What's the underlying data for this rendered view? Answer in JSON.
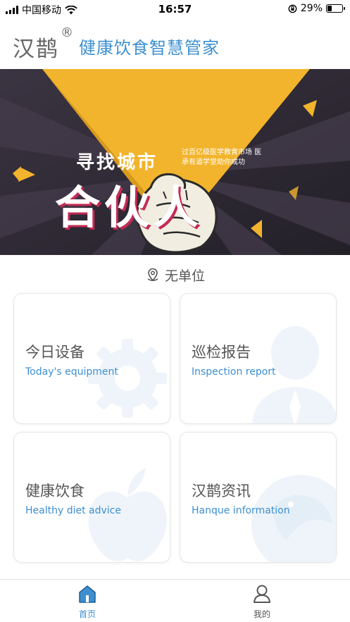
{
  "status_bar": {
    "carrier": "中国移动",
    "time": "16:57",
    "battery": "29%",
    "battery_level": 0.29
  },
  "header": {
    "brand": "汉鹊",
    "reg_mark": "®",
    "tagline": "健康饮食智慧管家"
  },
  "banner": {
    "headline": "寻找城市",
    "subline": "过百亿级医学教育市场 医承有道学堂助你成功",
    "main": "合伙人"
  },
  "location": {
    "text": "无单位"
  },
  "cards": [
    {
      "title": "今日设备",
      "subtitle": "Today's equipment"
    },
    {
      "title": "巡检报告",
      "subtitle": "Inspection report"
    },
    {
      "title": "健康饮食",
      "subtitle": "Healthy diet advice"
    },
    {
      "title": "汉鹊资讯",
      "subtitle": "Hanque information"
    }
  ],
  "tabs": [
    {
      "label": "首页",
      "icon": "home-icon",
      "active": true,
      "color": "#3d8fd0"
    },
    {
      "label": "我的",
      "icon": "user-icon",
      "active": false,
      "color": "#555555"
    }
  ],
  "colors": {
    "accent": "#3d8fd0",
    "banner_yellow": "#f2b42c",
    "banner_dark": "#2e2b36"
  }
}
